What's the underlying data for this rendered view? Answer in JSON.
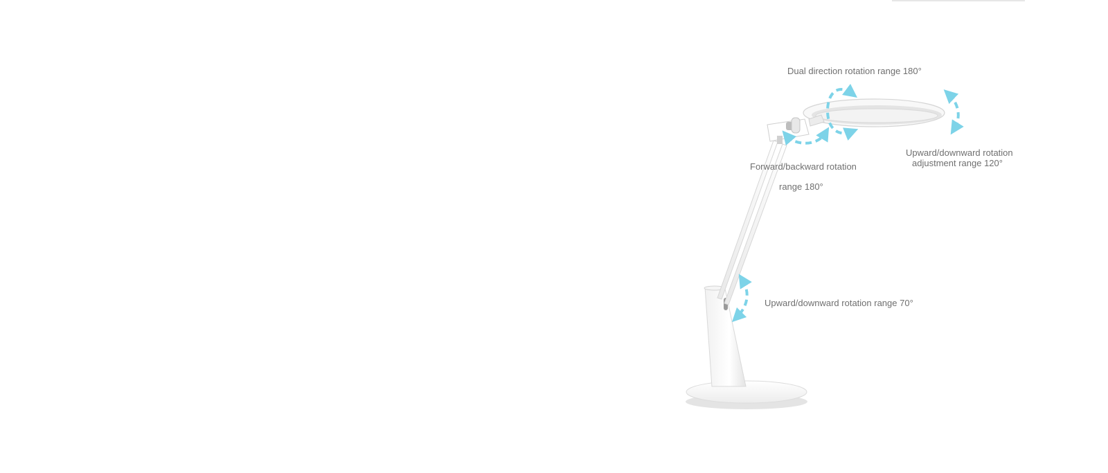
{
  "captions": {
    "dual_rotation": "Dual direction rotation range 180°",
    "forward_backward_line1": "Forward/backward rotation",
    "forward_backward_line2": "range 180°",
    "head_tilt_line1": "Upward/downward rotation",
    "head_tilt_line2": "adjustment range 120°",
    "arm_tilt": "Upward/downward rotation range 70°"
  },
  "colors": {
    "background": "#ffffff",
    "caption_text": "#6f6f6f",
    "arrow_accent": "#7dd3e8",
    "lamp_body": "#ffffff",
    "lamp_shade": "#e9e9e9"
  }
}
